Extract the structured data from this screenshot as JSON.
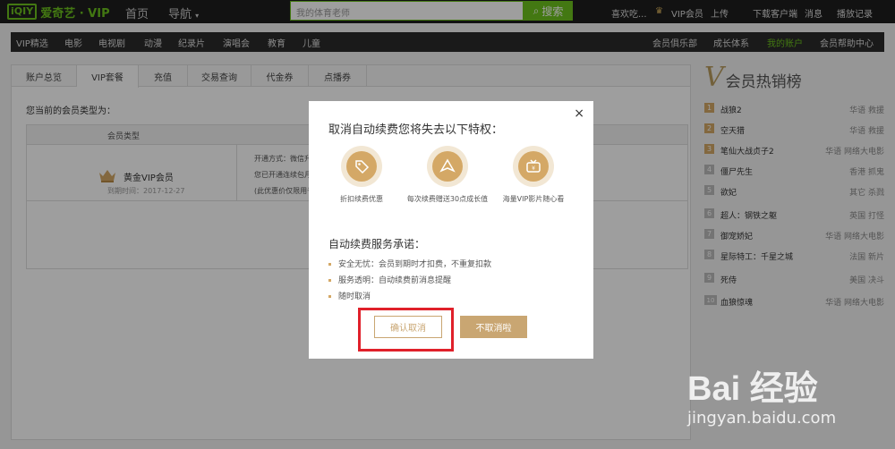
{
  "topbar": {
    "logo_box": "iQIY",
    "logo_text": "爱奇艺 · VIP",
    "home": "首页",
    "nav": "导航",
    "search_placeholder": "我的体育老师",
    "search_button": "搜索",
    "user": "喜欢吃...",
    "vip": "VIP会员",
    "upload": "上传",
    "download": "下载客户端",
    "messages": "消息",
    "history": "播放记录"
  },
  "navbar": {
    "items": [
      "VIP精选",
      "电影",
      "电视剧",
      "动漫",
      "纪录片",
      "演唱会",
      "教育",
      "儿童"
    ],
    "right": [
      "会员俱乐部",
      "成长体系",
      "我的账户",
      "会员帮助中心"
    ],
    "active": "我的账户"
  },
  "tabs": [
    "账户总览",
    "VIP套餐",
    "充值",
    "交易查询",
    "代金券",
    "点播券"
  ],
  "active_tab": "VIP套餐",
  "account": {
    "member_type_label": "您当前的会员类型为：",
    "col_type": "会员类型",
    "gold": "黄金VIP会员",
    "expire": "到期时间：2017-12-27",
    "line1": "开通方式：微信升级",
    "line2": "您已开通连续包月服",
    "line3": "(此优惠价仅限用于连"
  },
  "hot": {
    "v": "V",
    "title": "会员热销榜",
    "items": [
      {
        "rank": "1",
        "name": "战狼2",
        "tag": "华语 救援"
      },
      {
        "rank": "2",
        "name": "空天猎",
        "tag": "华语 救援"
      },
      {
        "rank": "3",
        "name": "笔仙大战贞子2",
        "tag": "华语 网络大电影"
      },
      {
        "rank": "4",
        "name": "僵尸先生",
        "tag": "香港 抓鬼"
      },
      {
        "rank": "5",
        "name": "欲妃",
        "tag": "其它 杀戮"
      },
      {
        "rank": "6",
        "name": "超人：钢铁之躯",
        "tag": "英国 打怪"
      },
      {
        "rank": "7",
        "name": "御宠娇妃",
        "tag": "华语 网络大电影"
      },
      {
        "rank": "8",
        "name": "星际特工：千星之城",
        "tag": "法国 新片"
      },
      {
        "rank": "9",
        "name": "死侍",
        "tag": "美国 决斗"
      },
      {
        "rank": "10",
        "name": "血狼惊魂",
        "tag": "华语 网络大电影"
      }
    ]
  },
  "modal": {
    "close": "×",
    "title": "取消自动续费您将失去以下特权：",
    "privileges": [
      {
        "label": "折扣续费优惠",
        "icon": "discount-tag-icon"
      },
      {
        "label": "每次续费赠送30点成长值",
        "icon": "growth-arrow-icon"
      },
      {
        "label": "海量VIP影片随心看",
        "icon": "tv-icon"
      }
    ],
    "promise_title": "自动续费服务承诺：",
    "promises": [
      "安全无忧：会员到期时才扣费，不重复扣款",
      "服务透明：自动续费前消息提醒",
      "随时取消"
    ],
    "confirm": "确认取消",
    "keep": "不取消啦"
  },
  "watermark": {
    "brand": "Bai 经验",
    "url": "jingyan.baidu.com"
  },
  "colors": {
    "accent": "#6cc21d",
    "gold": "#c9a672",
    "highlight": "#e0202a"
  }
}
